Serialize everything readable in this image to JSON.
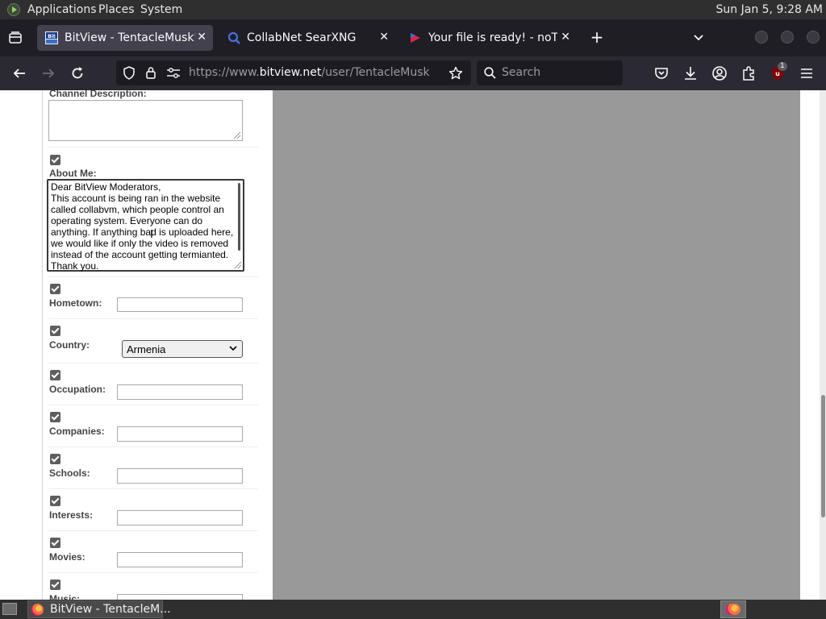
{
  "system_panel": {
    "menus": [
      "Applications",
      "Places",
      "System"
    ],
    "clock": "Sun Jan  5,  9:28 AM"
  },
  "tabs": [
    {
      "title": "BitView - TentacleMusk's Ch",
      "active": true,
      "favicon": "bitview-logo-icon"
    },
    {
      "title": "CollabNet SearXNG",
      "active": false,
      "favicon": "searxng-icon"
    },
    {
      "title": "Your file is ready! - noTube",
      "active": false,
      "favicon": "notube-icon"
    }
  ],
  "navbar": {
    "url_prefix": "https://www.",
    "url_domain": "bitview.net",
    "url_path": "/user/TentacleMusk",
    "search_placeholder": "Search",
    "extension_badge": "1"
  },
  "form": {
    "channel_description": {
      "label": "Channel Description:",
      "value": ""
    },
    "about_me": {
      "label": "About Me:",
      "checked": true,
      "value": "Dear BitView Moderators,\nThis account is being ran in the website called collabvm, which people control an operating system. Everyone can do anything. If anything bad is uploaded here, we would like if only the video is removed instead of the account getting termianted.\nThank you."
    },
    "hometown": {
      "label": "Hometown:",
      "checked": true,
      "value": ""
    },
    "country": {
      "label": "Country:",
      "checked": true,
      "value": "Armenia"
    },
    "occupation": {
      "label": "Occupation:",
      "checked": true,
      "value": ""
    },
    "companies": {
      "label": "Companies:",
      "checked": true,
      "value": ""
    },
    "schools": {
      "label": "Schools:",
      "checked": true,
      "value": ""
    },
    "interests": {
      "label": "Interests:",
      "checked": true,
      "value": ""
    },
    "movies": {
      "label": "Movies:",
      "checked": true,
      "value": ""
    },
    "music": {
      "label": "Music:",
      "checked": true,
      "value": ""
    }
  },
  "taskbar": {
    "window_title": "BitView - TentacleM..."
  },
  "colors": {
    "tab_strip": "#1f1e25",
    "active_tab": "#42414d",
    "page_gray": "#999999",
    "checkbox": "#5e5e5e"
  }
}
